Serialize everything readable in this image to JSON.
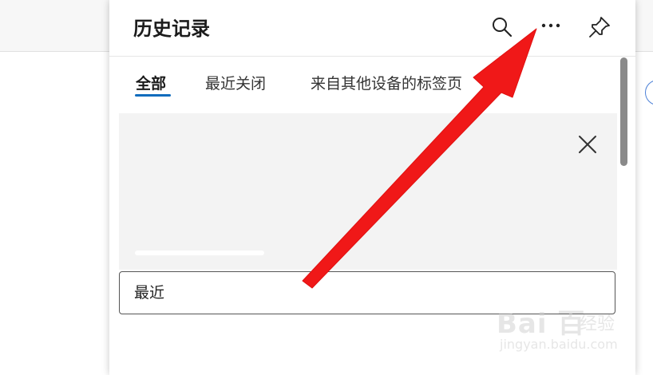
{
  "panel": {
    "title": "历史记录",
    "header_icons": [
      "search-icon",
      "more-options-icon",
      "pin-icon"
    ]
  },
  "tabs": [
    {
      "label": "全部",
      "active": true
    },
    {
      "label": "最近关闭",
      "active": false
    },
    {
      "label": "来自其他设备的标签页",
      "active": false
    }
  ],
  "banner": {
    "close_icon": "close-icon"
  },
  "search": {
    "placeholder": "最近"
  },
  "watermark": {
    "logo": "Bai 百",
    "text": "经验",
    "url": "jingyan.baidu.com"
  },
  "colors": {
    "accent": "#0f6cbd",
    "arrow": "#f01818",
    "banner_bg": "#f3f3f3"
  }
}
